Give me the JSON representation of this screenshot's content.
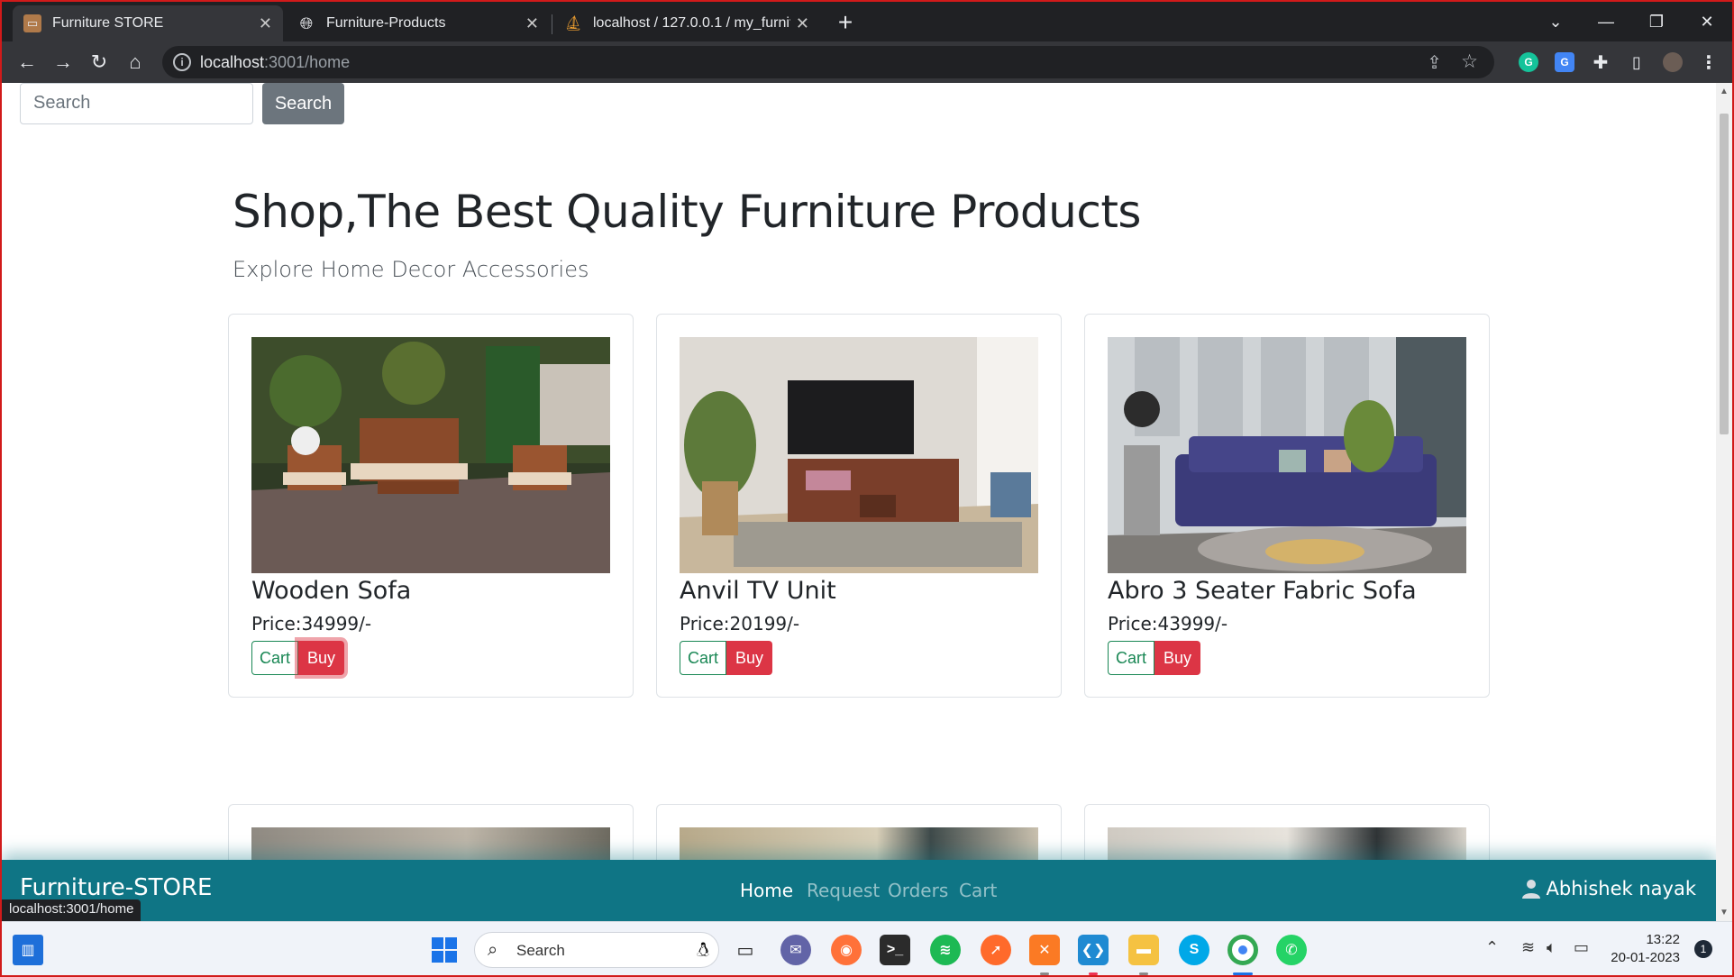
{
  "browser": {
    "tabs": [
      {
        "title": "Furniture STORE",
        "active": true
      },
      {
        "title": "Furniture-Products",
        "active": false
      },
      {
        "title": "localhost / 127.0.0.1 / my_furnitu",
        "active": false
      }
    ],
    "url_host": "localhost",
    "url_path": ":3001/home",
    "status_url": "localhost:3001/home"
  },
  "page": {
    "search": {
      "placeholder": "Search",
      "button": "Search"
    },
    "heading": "Shop,The Best Quality Furniture Products",
    "subheading": "Explore Home Decor Accessories",
    "products": [
      {
        "name": "Wooden Sofa",
        "price": "Price:34999/-",
        "cart": "Cart",
        "buy": "Buy"
      },
      {
        "name": "Anvil TV Unit",
        "price": "Price:20199/-",
        "cart": "Cart",
        "buy": "Buy"
      },
      {
        "name": "Abro 3 Seater Fabric Sofa",
        "price": "Price:43999/-",
        "cart": "Cart",
        "buy": "Buy"
      }
    ],
    "navbar": {
      "brand": "Furniture-STORE",
      "links": [
        "Home",
        "Request",
        "Orders",
        "Cart"
      ],
      "user": "Abhishek nayak"
    }
  },
  "taskbar": {
    "search_label": "Search",
    "time": "13:22",
    "date": "20-01-2023",
    "notification_count": "1"
  },
  "colors": {
    "navbar": "#0f7585",
    "buy": "#dc3545",
    "cart": "#198754",
    "search_button": "#6c757d"
  }
}
